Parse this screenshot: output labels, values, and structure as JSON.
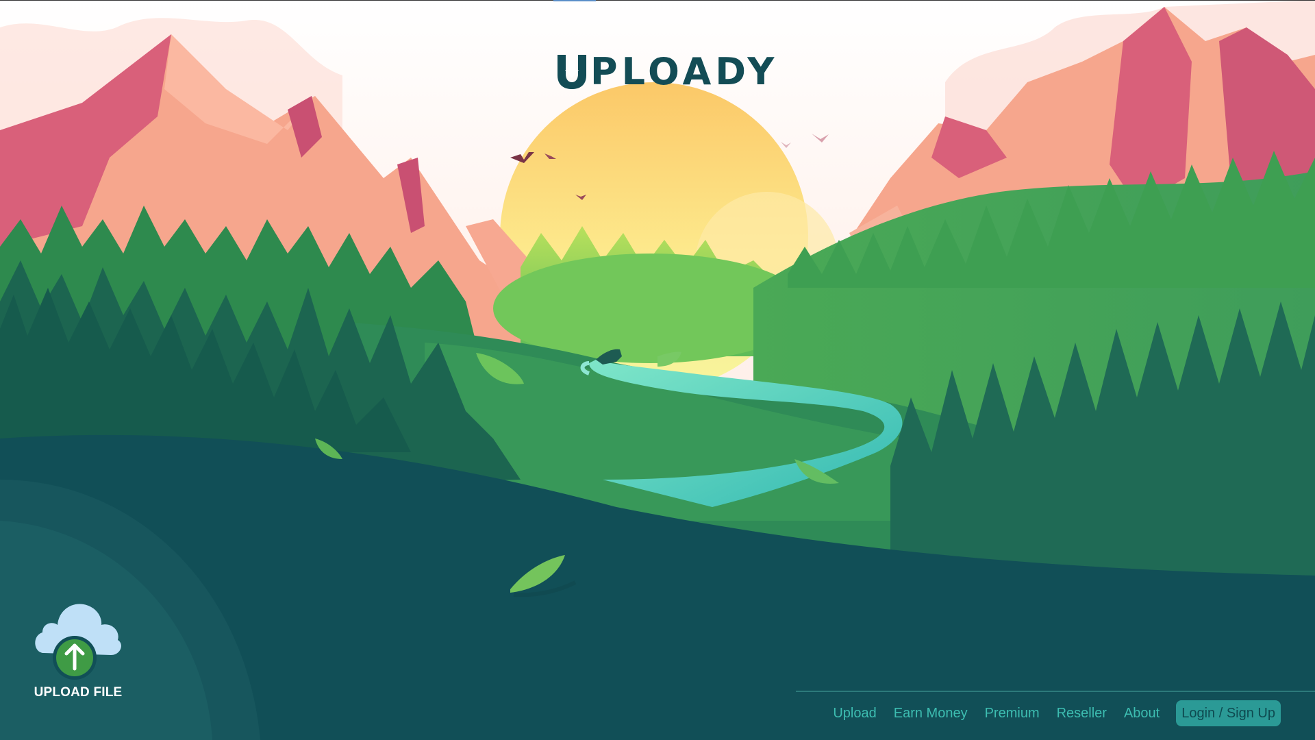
{
  "brand": {
    "name": "PLOADY"
  },
  "upload_widget": {
    "label": "UPLOAD FILE",
    "icon": "cloud-upload-icon"
  },
  "footer_nav": {
    "items": [
      "Upload",
      "Earn Money",
      "Premium",
      "Reseller",
      "About"
    ],
    "login_label": "Login / Sign Up"
  },
  "colors": {
    "brand": "#134c55",
    "nav_link": "#3dbdb1",
    "login_bg": "#2b9a96",
    "upload_arrow_circle": "#3f9b45",
    "cloud": "#bfe0f7"
  }
}
